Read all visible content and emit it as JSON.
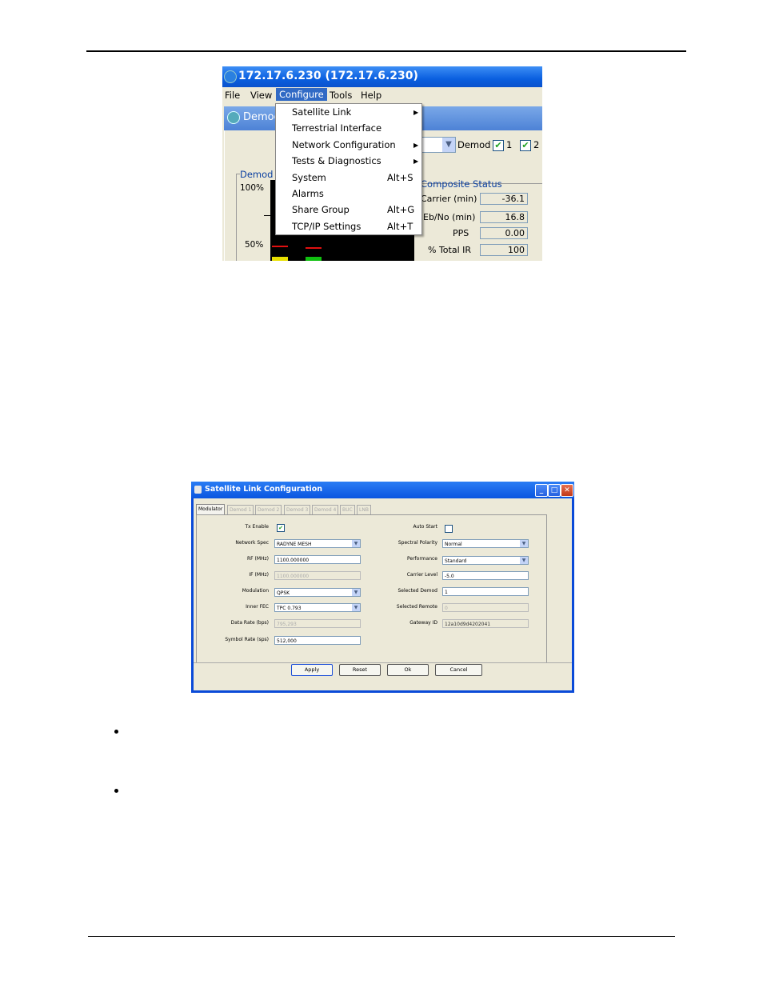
{
  "screenshot1": {
    "title": "172.17.6.230 (172.17.6.230)",
    "menubar": [
      "File",
      "View",
      "Configure",
      "Tools",
      "Help"
    ],
    "inner_title_partial": "Democ",
    "demod_label": "Demod",
    "demod_check1": "1",
    "demod_check2": "2",
    "demod_group_label": "Demod 1",
    "pct_100": "100%",
    "pct_50": "50%",
    "composite_status": {
      "label": "Composite Status",
      "rows": [
        {
          "label": "Carrier (min)",
          "value": "-36.1"
        },
        {
          "label": "Eb/No (min)",
          "value": "16.8"
        },
        {
          "label": "PPS",
          "value": "0.00"
        },
        {
          "label": "% Total IR",
          "value": "100"
        }
      ]
    },
    "configure_menu": [
      {
        "label": "Satellite Link",
        "shortcut": "",
        "submenu": true
      },
      {
        "label": "Terrestrial Interface",
        "shortcut": "",
        "submenu": false
      },
      {
        "label": "Network Configuration",
        "shortcut": "",
        "submenu": true
      },
      {
        "label": "Tests & Diagnostics",
        "shortcut": "",
        "submenu": true
      },
      {
        "label": "System",
        "shortcut": "Alt+S",
        "submenu": false
      },
      {
        "label": "Alarms",
        "shortcut": "",
        "submenu": false
      },
      {
        "label": "Share Group",
        "shortcut": "Alt+G",
        "submenu": false
      },
      {
        "label": "TCP/IP Settings",
        "shortcut": "Alt+T",
        "submenu": false
      }
    ]
  },
  "screenshot2": {
    "title": "Satellite Link Configuration",
    "tabs": [
      "Modulator",
      "Demod 1",
      "Demod 2",
      "Demod 3",
      "Demod 4",
      "BUC",
      "LNB"
    ],
    "active_tab": "Modulator",
    "left_fields": [
      {
        "label": "Tx Enable",
        "type": "checkbox",
        "checked": true
      },
      {
        "label": "Network Spec",
        "type": "select",
        "value": "RADYNE MESH"
      },
      {
        "label": "RF (MHz)",
        "type": "text",
        "value": "1100.000000"
      },
      {
        "label": "IF (MHz)",
        "type": "text-disabled",
        "value": "1100.000000"
      },
      {
        "label": "Modulation",
        "type": "select",
        "value": "QPSK"
      },
      {
        "label": "Inner FEC",
        "type": "select",
        "value": "TPC 0.793"
      },
      {
        "label": "Data Rate (bps)",
        "type": "text-disabled",
        "value": "795,293"
      },
      {
        "label": "Symbol Rate (sps)",
        "type": "text",
        "value": "512,000"
      }
    ],
    "right_fields": [
      {
        "label": "Auto Start",
        "type": "checkbox",
        "checked": false
      },
      {
        "label": "Spectral Polarity",
        "type": "select",
        "value": "Normal"
      },
      {
        "label": "Performance",
        "type": "select",
        "value": "Standard"
      },
      {
        "label": "Carrier Level",
        "type": "text",
        "value": "-5.0"
      },
      {
        "label": "Selected Demod",
        "type": "text",
        "value": "1"
      },
      {
        "label": "Selected Remote",
        "type": "text-disabled",
        "value": "0"
      },
      {
        "label": "Gateway ID",
        "type": "text-disabled-dark",
        "value": "12a10d9d4202041"
      }
    ],
    "buttons": [
      "Apply",
      "Reset",
      "Ok",
      "Cancel"
    ]
  }
}
